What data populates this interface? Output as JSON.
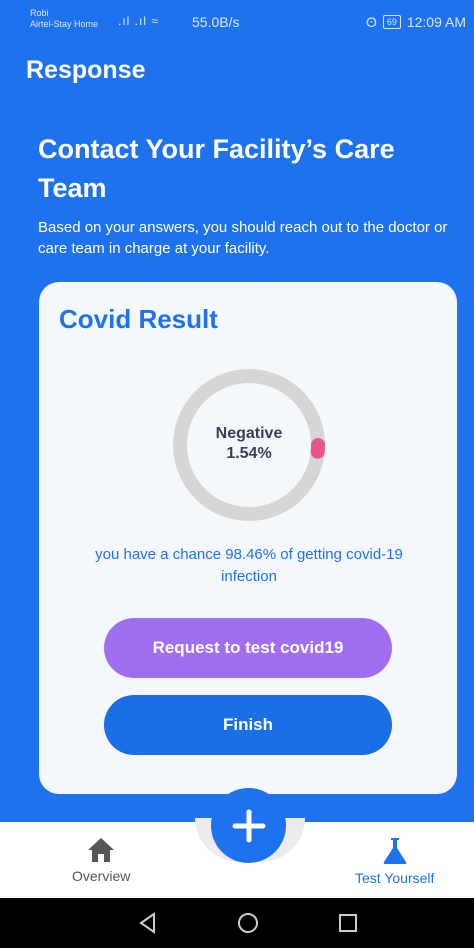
{
  "status_bar": {
    "carrier_line1": "Robi",
    "carrier_line2": "Airtel-Stay Home",
    "network_speed": "55.0B/s",
    "battery_level": "69",
    "time": "12:09 AM"
  },
  "header": {
    "title": "Response"
  },
  "main": {
    "heading": "Contact Your Facility’s Care Team",
    "description": "Based on your answers, you should reach out to the doctor or care team in charge at your facility."
  },
  "result_card": {
    "title": "Covid Result",
    "status": "Negative",
    "percentage": "1.54%",
    "percentage_value": 1.54,
    "chance_text": "you have a chance 98.46% of getting covid-19 infection",
    "request_button_label": "Request to test covid19",
    "finish_button_label": "Finish"
  },
  "bottom_nav": {
    "items": [
      {
        "label": "Overview",
        "icon": "home-icon"
      },
      {
        "label": "Test Yourself",
        "icon": "flask-icon"
      }
    ],
    "fab_icon": "plus-icon"
  },
  "colors": {
    "primary": "#1f72ee",
    "purple_button": "#a06ff0",
    "ring_track": "#d6d6d6",
    "ring_value": "#e8558a"
  }
}
